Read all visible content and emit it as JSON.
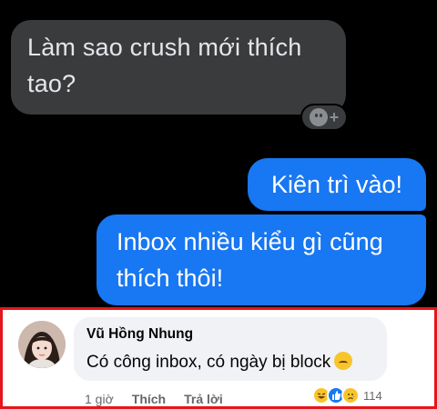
{
  "chat": {
    "incoming_message": "Làm sao crush mới thích tao?",
    "outgoing_messages": [
      "Kiên trì vào!",
      "Inbox nhiều kiểu gì cũng thích thôi!"
    ],
    "react_icon": "add-reaction-icon"
  },
  "comment": {
    "author": "Vũ Hồng Nhung",
    "text": "Có công inbox, có ngày bị block",
    "emoji": "slightly-smiling-face",
    "time": "1 giờ",
    "like_label": "Thích",
    "reply_label": "Trả lời",
    "reaction_icons": [
      "haha-icon",
      "like-icon",
      "sad-icon"
    ],
    "reaction_count": "114"
  },
  "colors": {
    "outgoing_bubble": "#1877f2",
    "incoming_bubble": "#3a3b3c",
    "highlight_border": "#e4161b"
  }
}
